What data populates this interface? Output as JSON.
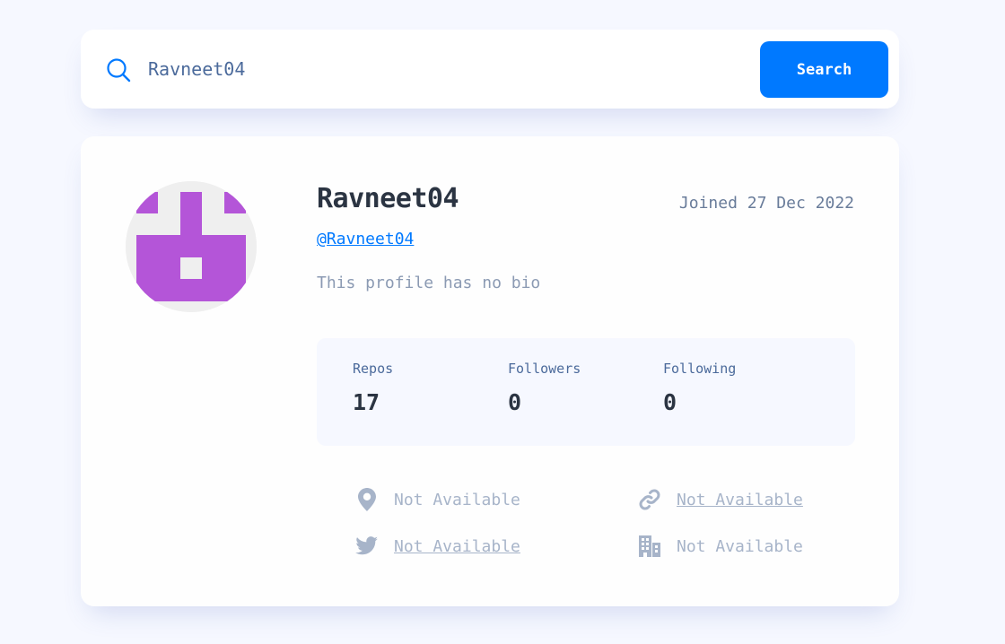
{
  "search": {
    "value": "Ravneet04",
    "button_label": "Search"
  },
  "profile": {
    "name": "Ravneet04",
    "login": "@Ravneet04",
    "joined": "Joined 27 Dec 2022",
    "bio": "This profile has no bio",
    "stats": [
      {
        "label": "Repos",
        "value": "17"
      },
      {
        "label": "Followers",
        "value": "0"
      },
      {
        "label": "Following",
        "value": "0"
      }
    ],
    "links": {
      "location": "Not Available",
      "blog": "Not Available",
      "twitter": "Not Available",
      "company": "Not Available"
    }
  },
  "icons": {
    "search": "search-icon",
    "location": "location-pin-icon",
    "blog": "link-chain-icon",
    "twitter": "twitter-bird-icon",
    "company": "building-icon"
  },
  "colors": {
    "accent": "#0079ff",
    "avatar_fill": "#b455d8",
    "text_dark": "#2b3442",
    "text_muted": "#a7b4c9"
  }
}
